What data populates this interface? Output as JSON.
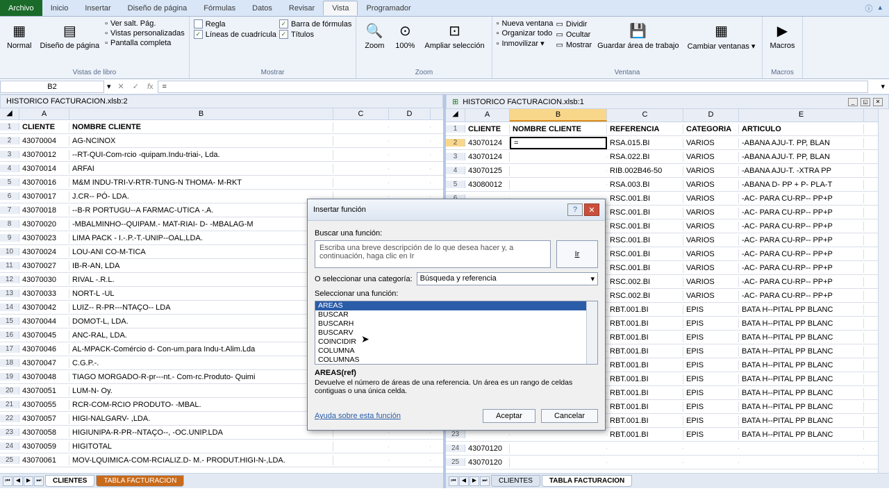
{
  "tabs": {
    "file": "Archivo",
    "inicio": "Inicio",
    "insertar": "Insertar",
    "diseno": "Diseño de página",
    "formulas": "Fórmulas",
    "datos": "Datos",
    "revisar": "Revisar",
    "vista": "Vista",
    "programador": "Programador"
  },
  "ribbon": {
    "vistas": {
      "normal": "Normal",
      "diseno": "Diseño de página",
      "salto": "Ver salt. Pág.",
      "perso": "Vistas personalizadas",
      "completa": "Pantalla completa",
      "grupo": "Vistas de libro"
    },
    "mostrar": {
      "regla": "Regla",
      "formula": "Barra de fórmulas",
      "cuadric": "Líneas de cuadrícula",
      "titulos": "Títulos",
      "grupo": "Mostrar"
    },
    "zoom": {
      "zoom": "Zoom",
      "cien": "100%",
      "sel": "Ampliar selección",
      "grupo": "Zoom"
    },
    "ventana": {
      "nueva": "Nueva ventana",
      "org": "Organizar todo",
      "inmov": "Inmovilizar ▾",
      "div": "Dividir",
      "ocultar": "Ocultar",
      "mostr": "Mostrar",
      "guardar": "Guardar área de trabajo",
      "cambiar": "Cambiar ventanas ▾",
      "grupo": "Ventana"
    },
    "macros": {
      "btn": "Macros",
      "grupo": "Macros"
    }
  },
  "namebox": "B2",
  "formula": "=",
  "paneLeft": {
    "title": "HISTORICO FACTURACION.xlsb:2",
    "cols": [
      "A",
      "B",
      "C",
      "D"
    ],
    "header": [
      "CLIENTE",
      "NOMBRE CLIENTE",
      "",
      ""
    ],
    "rows": [
      [
        "43070004",
        "AG-NCINOX"
      ],
      [
        "43070012",
        "--RT-QUI-Com-rcio -quipam.Indu-triai-, Lda."
      ],
      [
        "43070014",
        "ARFAI"
      ],
      [
        "43070016",
        "M&M INDU-TRI-V-RTR-TUNG-N THOMA- M-RKT"
      ],
      [
        "43070017",
        "J.CR-- PÓ- LDA."
      ],
      [
        "43070018",
        "--B-R PORTUGU--A FARMAC-UTICA -.A."
      ],
      [
        "43070020",
        "-MBALMINHO--QUIPAM.- MAT-RIAI- D- -MBALAG-M"
      ],
      [
        "43070023",
        "LIMA PACK - I.-.P.-T.-UNIP--OAL,LDA."
      ],
      [
        "43070024",
        "LOU-ANI CO-M-TICA"
      ],
      [
        "43070027",
        "IB-R-AN, LDA"
      ],
      [
        "43070030",
        "RIVAL -.R.L."
      ],
      [
        "43070033",
        "NORT-L -UL"
      ],
      [
        "43070042",
        "LUIZ-- R-PR---NTAÇO-- LDA"
      ],
      [
        "43070044",
        "DOMOT-L, LDA."
      ],
      [
        "43070045",
        "ANC-RAL, LDA."
      ],
      [
        "43070046",
        "AL-MPACK-Comércio d- Con-um.para Indu-t.Alim.Lda"
      ],
      [
        "43070047",
        "C.G.P.-."
      ],
      [
        "43070048",
        "TIAGO MORGADO-R-pr---nt.- Com-rc.Produto- Quimi"
      ],
      [
        "43070051",
        "LUM-N- Oy."
      ],
      [
        "43070055",
        "RCR-COM-RCIO PRODUTO- -MBAL."
      ],
      [
        "43070057",
        "HIGI-NALGARV- ,LDA."
      ],
      [
        "43070058",
        "HIGIUNIPA-R-PR--NTAÇO--, -OC.UNIP.LDA"
      ],
      [
        "43070059",
        "HIGITOTAL"
      ],
      [
        "43070061",
        "MOV-LQUIMICA-COM-RCIALIZ.D- M.- PRODUT.HIGI-N-,LDA."
      ]
    ],
    "sheets": [
      "CLIENTES",
      "TABLA FACTURACION"
    ]
  },
  "paneRight": {
    "title": "HISTORICO FACTURACION.xlsb:1",
    "cols": [
      "A",
      "B",
      "C",
      "D",
      "E"
    ],
    "header": [
      "CLIENTE",
      "NOMBRE CLIENTE",
      "REFERENCIA",
      "CATEGORIA",
      "ARTICULO"
    ],
    "rows": [
      [
        "43070124",
        "=",
        "RSA.015.BI",
        "VARIOS",
        "-ABANA AJU-T. PP, BLAN"
      ],
      [
        "43070124",
        "",
        "RSA.022.BI",
        "VARIOS",
        "-ABANA AJU-T. PP, BLAN"
      ],
      [
        "43070125",
        "",
        "RIB.002B46-50",
        "VARIOS",
        "-ABANA AJU-T. -XTRA PP"
      ],
      [
        "43080012",
        "",
        "RSA.003.BI",
        "VARIOS",
        "-ABANA D- PP + P- PLA-T"
      ],
      [
        "",
        "",
        "RSC.001.BI",
        "VARIOS",
        "-AC- PARA CU-RP-- PP+P"
      ],
      [
        "",
        "",
        "RSC.001.BI",
        "VARIOS",
        "-AC- PARA CU-RP-- PP+P"
      ],
      [
        "",
        "",
        "RSC.001.BI",
        "VARIOS",
        "-AC- PARA CU-RP-- PP+P"
      ],
      [
        "",
        "",
        "RSC.001.BI",
        "VARIOS",
        "-AC- PARA CU-RP-- PP+P"
      ],
      [
        "",
        "",
        "RSC.001.BI",
        "VARIOS",
        "-AC- PARA CU-RP-- PP+P"
      ],
      [
        "",
        "",
        "RSC.001.BI",
        "VARIOS",
        "-AC- PARA CU-RP-- PP+P"
      ],
      [
        "",
        "",
        "RSC.002.BI",
        "VARIOS",
        "-AC- PARA CU-RP-- PP+P"
      ],
      [
        "",
        "",
        "RSC.002.BI",
        "VARIOS",
        "-AC- PARA CU-RP-- PP+P"
      ],
      [
        "",
        "",
        "RBT.001.BI",
        "EPIS",
        "BATA H--PITAL PP BLANC"
      ],
      [
        "",
        "",
        "RBT.001.BI",
        "EPIS",
        "BATA H--PITAL PP BLANC"
      ],
      [
        "",
        "",
        "RBT.001.BI",
        "EPIS",
        "BATA H--PITAL PP BLANC"
      ],
      [
        "",
        "",
        "RBT.001.BI",
        "EPIS",
        "BATA H--PITAL PP BLANC"
      ],
      [
        "",
        "",
        "RBT.001.BI",
        "EPIS",
        "BATA H--PITAL PP BLANC"
      ],
      [
        "",
        "",
        "RBT.001.BI",
        "EPIS",
        "BATA H--PITAL PP BLANC"
      ],
      [
        "",
        "",
        "RBT.001.BI",
        "EPIS",
        "BATA H--PITAL PP BLANC"
      ],
      [
        "",
        "",
        "RBT.001.BI",
        "EPIS",
        "BATA H--PITAL PP BLANC"
      ],
      [
        "",
        "",
        "RBT.001.BI",
        "EPIS",
        "BATA H--PITAL PP BLANC"
      ],
      [
        "",
        "",
        "RBT.001.BI",
        "EPIS",
        "BATA H--PITAL PP BLANC"
      ],
      [
        "43070120",
        "",
        "",
        "",
        ""
      ],
      [
        "43070120",
        "",
        "",
        "",
        ""
      ]
    ],
    "sheets": [
      "CLIENTES",
      "TABLA FACTURACION"
    ]
  },
  "dialog": {
    "title": "Insertar función",
    "searchLabel": "Buscar una función:",
    "searchText": "Escriba una breve descripción de lo que desea hacer y, a continuación, haga clic en Ir",
    "ir": "Ir",
    "catLabel": "O seleccionar una categoría:",
    "catValue": "Búsqueda y referencia",
    "selLabel": "Seleccionar una función:",
    "fns": [
      "AREAS",
      "BUSCAR",
      "BUSCARH",
      "BUSCARV",
      "COINCIDIR",
      "COLUMNA",
      "COLUMNAS"
    ],
    "sig": "AREAS(ref)",
    "desc": "Devuelve el número de áreas de una referencia. Un área es un rango de celdas contiguas o una única celda.",
    "help": "Ayuda sobre esta función",
    "ok": "Aceptar",
    "cancel": "Cancelar"
  }
}
